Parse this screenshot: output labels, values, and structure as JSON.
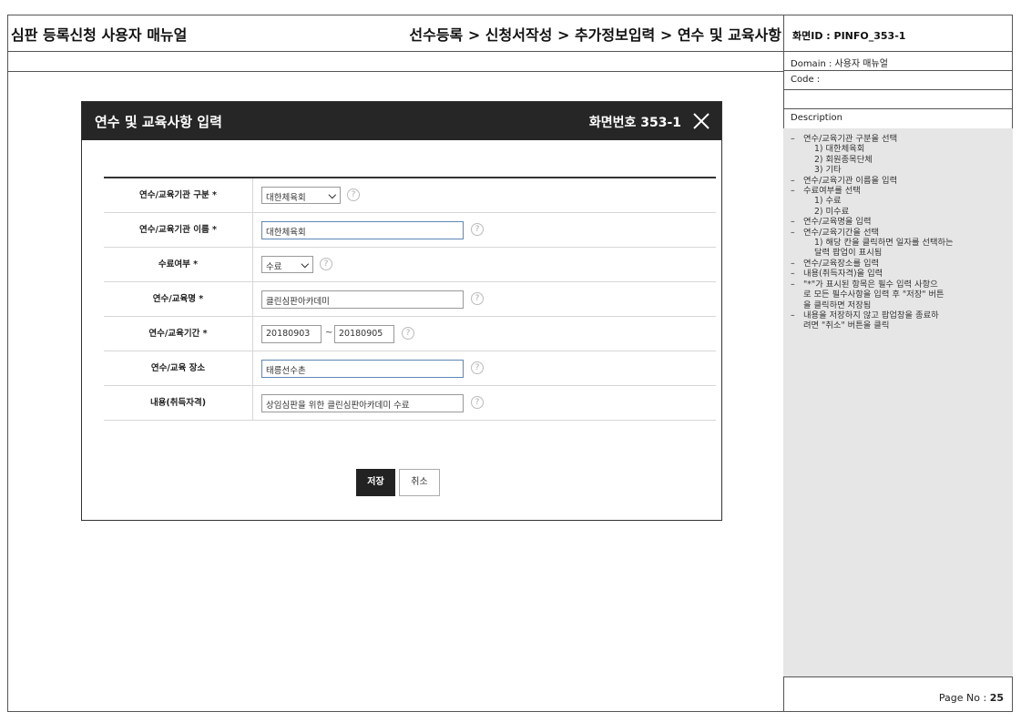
{
  "doc": {
    "title": "심판 등록신청 사용자 매뉴얼",
    "breadcrumb": "선수등록 > 신청서작성 > 추가정보입력 > 연수 및 교육사항"
  },
  "info": {
    "screen_id": "화면ID : PINFO_353-1",
    "domain": "Domain : 사용자 매뉴얼",
    "code": "Code :",
    "description_label": "Description",
    "page_label": "Page No : ",
    "page_number": "25",
    "description": [
      {
        "text": "연수/교육기관 구분을 선택",
        "subs": [
          "1) 대한체육회",
          "2) 회원종목단체",
          "3) 기타"
        ]
      },
      {
        "text": "연수/교육기관 이름을 입력",
        "subs": []
      },
      {
        "text": "수료여부를 선택",
        "subs": [
          "1) 수료",
          "2) 미수료"
        ]
      },
      {
        "text": "연수/교육명을 입력",
        "subs": []
      },
      {
        "text": "연수/교육기간을 선택",
        "subs": [
          "1) 해당 칸을 클릭하면 일자를 선택하는",
          "달력 팝업이 표시됨"
        ]
      },
      {
        "text": "연수/교육장소를 입력",
        "subs": []
      },
      {
        "text": "내용(취득자격)을 입력",
        "subs": []
      },
      {
        "text": "\"*\"가 표시된 항목은 필수 입력 사항으",
        "subs": []
      },
      {
        "text": "로 모든 필수사항을 입력 후 \"저장\" 버튼",
        "subs": [],
        "cont": true
      },
      {
        "text": "을 클릭하면 저장됨",
        "subs": [],
        "cont": true
      },
      {
        "text": "내용을 저장하지 않고 팝업창을 종료하",
        "subs": []
      },
      {
        "text": "려면 \"취소\" 버튼을 클릭",
        "subs": [],
        "cont": true
      }
    ]
  },
  "modal": {
    "title": "연수 및 교육사항 입력",
    "screen_no": "화면번호 353-1",
    "rows": {
      "org_type": {
        "label": "연수/교육기관 구분 *",
        "value": "대한체육회"
      },
      "org_name": {
        "label": "연수/교육기관 이름 *",
        "value": "대한체육회"
      },
      "completion": {
        "label": "수료여부 *",
        "value": "수료"
      },
      "course_name": {
        "label": "연수/교육명 *",
        "value": "클린심판아카데미"
      },
      "period": {
        "label": "연수/교육기간 *",
        "start": "20180903",
        "sep": "~",
        "end": "20180905"
      },
      "place": {
        "label": "연수/교육 장소",
        "value": "태릉선수촌"
      },
      "content": {
        "label": "내용(취득자격)",
        "value": "상임심판을 위한 클린심판아카데미 수료"
      }
    },
    "help": "?",
    "save_label": "저장",
    "cancel_label": "취소"
  },
  "icons": {
    "close": "close-icon",
    "chevron": "chevron-down-icon",
    "help": "help-icon"
  }
}
